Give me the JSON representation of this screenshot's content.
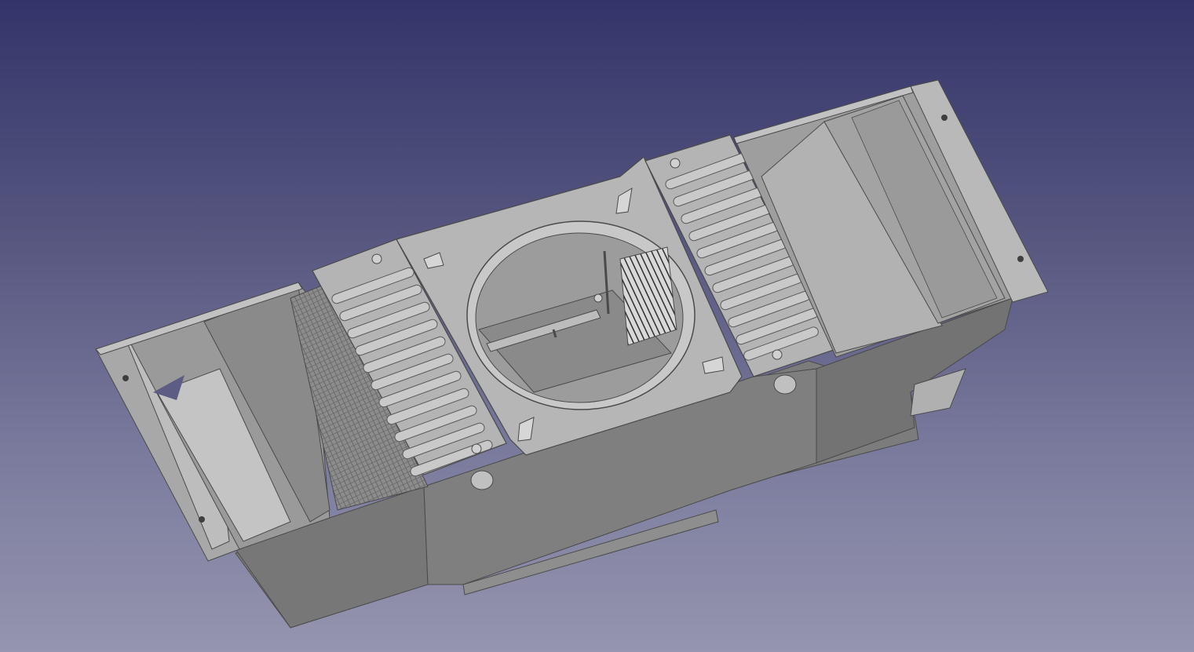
{
  "viewport": {
    "background_top": "#34346a",
    "background_bottom": "#9595af"
  },
  "model": {
    "icon": "cad-assembly-icon",
    "colors": {
      "face_light": "#b8b8b8",
      "face_mid": "#a4a4a4",
      "face_dark": "#707070",
      "edge": "#4a4a4a"
    },
    "fin_count_left": 12,
    "fin_count_right": 12
  }
}
